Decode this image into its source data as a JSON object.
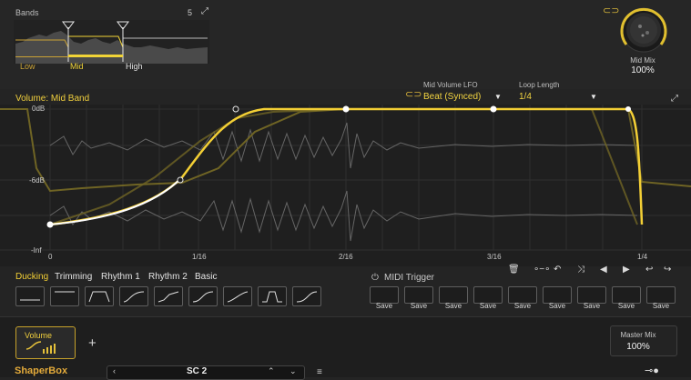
{
  "bands": {
    "title": "Bands",
    "count": "5",
    "labels": {
      "low": "Low",
      "mid": "Mid",
      "high": "High"
    }
  },
  "mid_mix": {
    "label": "Mid Mix",
    "value": "100%",
    "level": 1.0
  },
  "lfo": {
    "title": "Volume: Mid Band",
    "rate_label": "Mid Volume LFO",
    "rate_value": "Beat (Synced)",
    "loop_label": "Loop Length",
    "loop_value": "1/4"
  },
  "graph": {
    "y_labels": [
      "0dB",
      "-6dB",
      "-Inf"
    ],
    "x_labels": [
      "0",
      "1/16",
      "2/16",
      "3/16",
      "1/4"
    ]
  },
  "presets": {
    "names": [
      "Ducking",
      "Trimming",
      "Rhythm 1",
      "Rhythm 2",
      "Basic"
    ],
    "active": "Ducking"
  },
  "midi": {
    "label": "MIDI Trigger"
  },
  "save_slots": [
    "Save",
    "Save",
    "Save",
    "Save",
    "Save",
    "Save",
    "Save",
    "Save",
    "Save"
  ],
  "bottom": {
    "tab_label": "Volume",
    "add_label": "+",
    "master_label": "Master Mix",
    "master_value": "100%",
    "logo": "ShaperBox",
    "preset_name": "SC 2"
  },
  "colors": {
    "accent": "#f3cf35",
    "accent_dim": "#8a7a2a",
    "background": "#242424"
  }
}
